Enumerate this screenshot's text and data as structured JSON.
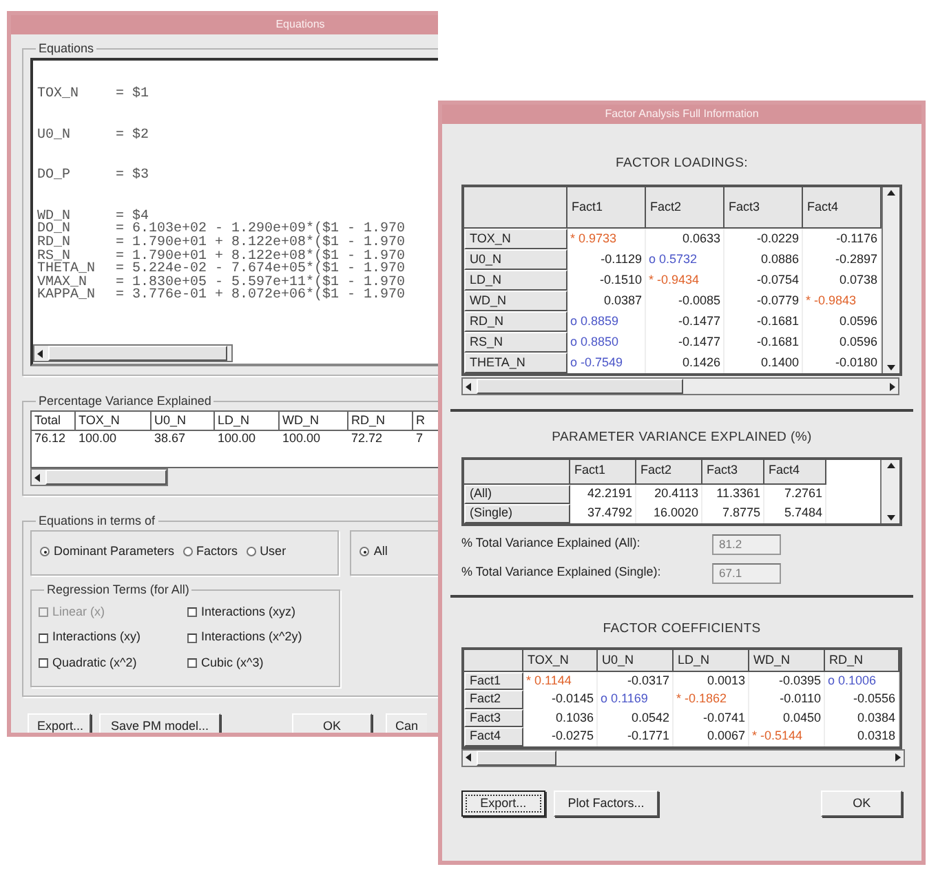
{
  "equations_window": {
    "title": "Equations",
    "equations": {
      "label": "Equations",
      "lines": [
        {
          "variable": "TOX_N",
          "expression": "= $1",
          "spaced": true
        },
        {
          "variable": "U0_N",
          "expression": "= $2",
          "spaced": true
        },
        {
          "variable": "DO_P",
          "expression": "= $3",
          "spaced": true
        },
        {
          "variable": "WD_N",
          "expression": "= $4",
          "spaced": false
        },
        {
          "variable": "DO_N",
          "expression": "= 6.103e+02 - 1.290e+09*($1 - 1.970",
          "spaced": false
        },
        {
          "variable": "RD_N",
          "expression": "= 1.790e+01 + 8.122e+08*($1 - 1.970",
          "spaced": false
        },
        {
          "variable": "RS_N",
          "expression": "= 1.790e+01 + 8.122e+08*($1 - 1.970",
          "spaced": false
        },
        {
          "variable": "THETA_N",
          "expression": "= 5.224e-02 - 7.674e+05*($1 - 1.970",
          "spaced": false
        },
        {
          "variable": "VMAX_N",
          "expression": "= 1.830e+05 - 5.597e+11*($1 - 1.970",
          "spaced": false
        },
        {
          "variable": "KAPPA_N",
          "expression": "= 3.776e-01 + 8.072e+06*($1 - 1.970",
          "spaced": false
        }
      ]
    },
    "variance": {
      "label": "Percentage Variance Explained",
      "columns": [
        "Total",
        "TOX_N",
        "U0_N",
        "LD_N",
        "WD_N",
        "RD_N",
        "R"
      ],
      "values": [
        "76.12",
        "100.00",
        "38.67",
        "100.00",
        "100.00",
        "72.72",
        "7"
      ]
    },
    "terms": {
      "label": "Equations in terms of",
      "basis": [
        {
          "label": "Dominant Parameters",
          "selected": true
        },
        {
          "label": "Factors",
          "selected": false
        },
        {
          "label": "User",
          "selected": false
        }
      ],
      "scope": [
        {
          "label": "All",
          "selected": true
        }
      ],
      "regression": {
        "label": "Regression Terms (for All)",
        "options": [
          {
            "label": "Linear (x)",
            "checked": false,
            "disabled": true
          },
          {
            "label": "Interactions (xyz)",
            "checked": false,
            "disabled": false
          },
          {
            "label": "Interactions (xy)",
            "checked": false,
            "disabled": false
          },
          {
            "label": "Interactions (x^2y)",
            "checked": false,
            "disabled": false
          },
          {
            "label": "Quadratic (x^2)",
            "checked": false,
            "disabled": false
          },
          {
            "label": "Cubic (x^3)",
            "checked": false,
            "disabled": false
          }
        ]
      }
    },
    "buttons": [
      "Export...",
      "Save PM model...",
      "OK",
      "Can"
    ]
  },
  "factor_window": {
    "title": "Factor Analysis Full Information",
    "loadings": {
      "title": "FACTOR LOADINGS:",
      "columns": [
        "Fact1",
        "Fact2",
        "Fact3",
        "Fact4"
      ],
      "rows": [
        {
          "label": "TOX_N",
          "cells": [
            {
              "text": "* 0.9733",
              "kind": "strong"
            },
            {
              "text": "0.0633",
              "kind": "plain"
            },
            {
              "text": "-0.0229",
              "kind": "plain"
            },
            {
              "text": "-0.1176",
              "kind": "plain"
            }
          ]
        },
        {
          "label": "U0_N",
          "cells": [
            {
              "text": "-0.1129",
              "kind": "plain"
            },
            {
              "text": "o 0.5732",
              "kind": "moderate"
            },
            {
              "text": "0.0886",
              "kind": "plain"
            },
            {
              "text": "-0.2897",
              "kind": "plain"
            }
          ]
        },
        {
          "label": "LD_N",
          "cells": [
            {
              "text": "-0.1510",
              "kind": "plain"
            },
            {
              "text": "* -0.9434",
              "kind": "strong"
            },
            {
              "text": "-0.0754",
              "kind": "plain"
            },
            {
              "text": "0.0738",
              "kind": "plain"
            }
          ]
        },
        {
          "label": "WD_N",
          "cells": [
            {
              "text": "0.0387",
              "kind": "plain"
            },
            {
              "text": "-0.0085",
              "kind": "plain"
            },
            {
              "text": "-0.0779",
              "kind": "plain"
            },
            {
              "text": "* -0.9843",
              "kind": "strong"
            }
          ]
        },
        {
          "label": "RD_N",
          "cells": [
            {
              "text": "o 0.8859",
              "kind": "moderate"
            },
            {
              "text": "-0.1477",
              "kind": "plain"
            },
            {
              "text": "-0.1681",
              "kind": "plain"
            },
            {
              "text": "0.0596",
              "kind": "plain"
            }
          ]
        },
        {
          "label": "RS_N",
          "cells": [
            {
              "text": "o 0.8850",
              "kind": "moderate"
            },
            {
              "text": "-0.1477",
              "kind": "plain"
            },
            {
              "text": "-0.1681",
              "kind": "plain"
            },
            {
              "text": "0.0596",
              "kind": "plain"
            }
          ]
        },
        {
          "label": "THETA_N",
          "cells": [
            {
              "text": "o -0.7549",
              "kind": "moderate"
            },
            {
              "text": "0.1426",
              "kind": "plain"
            },
            {
              "text": "0.1400",
              "kind": "plain"
            },
            {
              "text": "-0.0180",
              "kind": "plain"
            }
          ]
        }
      ]
    },
    "param_variance": {
      "title": "PARAMETER VARIANCE EXPLAINED (%)",
      "columns": [
        "Fact1",
        "Fact2",
        "Fact3",
        "Fact4"
      ],
      "rows": [
        {
          "label": "(All)",
          "cells": [
            "42.2191",
            "20.4113",
            "11.3361",
            "7.2761"
          ]
        },
        {
          "label": "(Single)",
          "cells": [
            "37.4792",
            "16.0020",
            "7.8775",
            "5.7484"
          ]
        }
      ],
      "totals": [
        {
          "label": "% Total Variance Explained (All):",
          "value": "81.2"
        },
        {
          "label": "% Total Variance Explained (Single):",
          "value": "67.1"
        }
      ]
    },
    "coefficients": {
      "title": "FACTOR COEFFICIENTS",
      "columns": [
        "TOX_N",
        "U0_N",
        "LD_N",
        "WD_N",
        "RD_N"
      ],
      "rows": [
        {
          "label": "Fact1",
          "cells": [
            {
              "text": "* 0.1144",
              "kind": "strong"
            },
            {
              "text": "-0.0317",
              "kind": "plain"
            },
            {
              "text": "0.0013",
              "kind": "plain"
            },
            {
              "text": "-0.0395",
              "kind": "plain"
            },
            {
              "text": "o 0.1006",
              "kind": "moderate"
            }
          ]
        },
        {
          "label": "Fact2",
          "cells": [
            {
              "text": "-0.0145",
              "kind": "plain"
            },
            {
              "text": "o 0.1169",
              "kind": "moderate"
            },
            {
              "text": "* -0.1862",
              "kind": "strong"
            },
            {
              "text": "-0.0110",
              "kind": "plain"
            },
            {
              "text": "-0.0556",
              "kind": "plain"
            }
          ]
        },
        {
          "label": "Fact3",
          "cells": [
            {
              "text": "0.1036",
              "kind": "plain"
            },
            {
              "text": "0.0542",
              "kind": "plain"
            },
            {
              "text": "-0.0741",
              "kind": "plain"
            },
            {
              "text": "0.0450",
              "kind": "plain"
            },
            {
              "text": "0.0384",
              "kind": "plain"
            }
          ]
        },
        {
          "label": "Fact4",
          "cells": [
            {
              "text": "-0.0275",
              "kind": "plain"
            },
            {
              "text": "-0.1771",
              "kind": "plain"
            },
            {
              "text": "0.0067",
              "kind": "plain"
            },
            {
              "text": "* -0.5144",
              "kind": "strong"
            },
            {
              "text": "0.0318",
              "kind": "plain"
            }
          ]
        }
      ]
    },
    "buttons": [
      {
        "label": "Export...",
        "focused": true
      },
      {
        "label": "Plot Factors...",
        "focused": false
      },
      {
        "label": "OK",
        "focused": false
      }
    ]
  }
}
